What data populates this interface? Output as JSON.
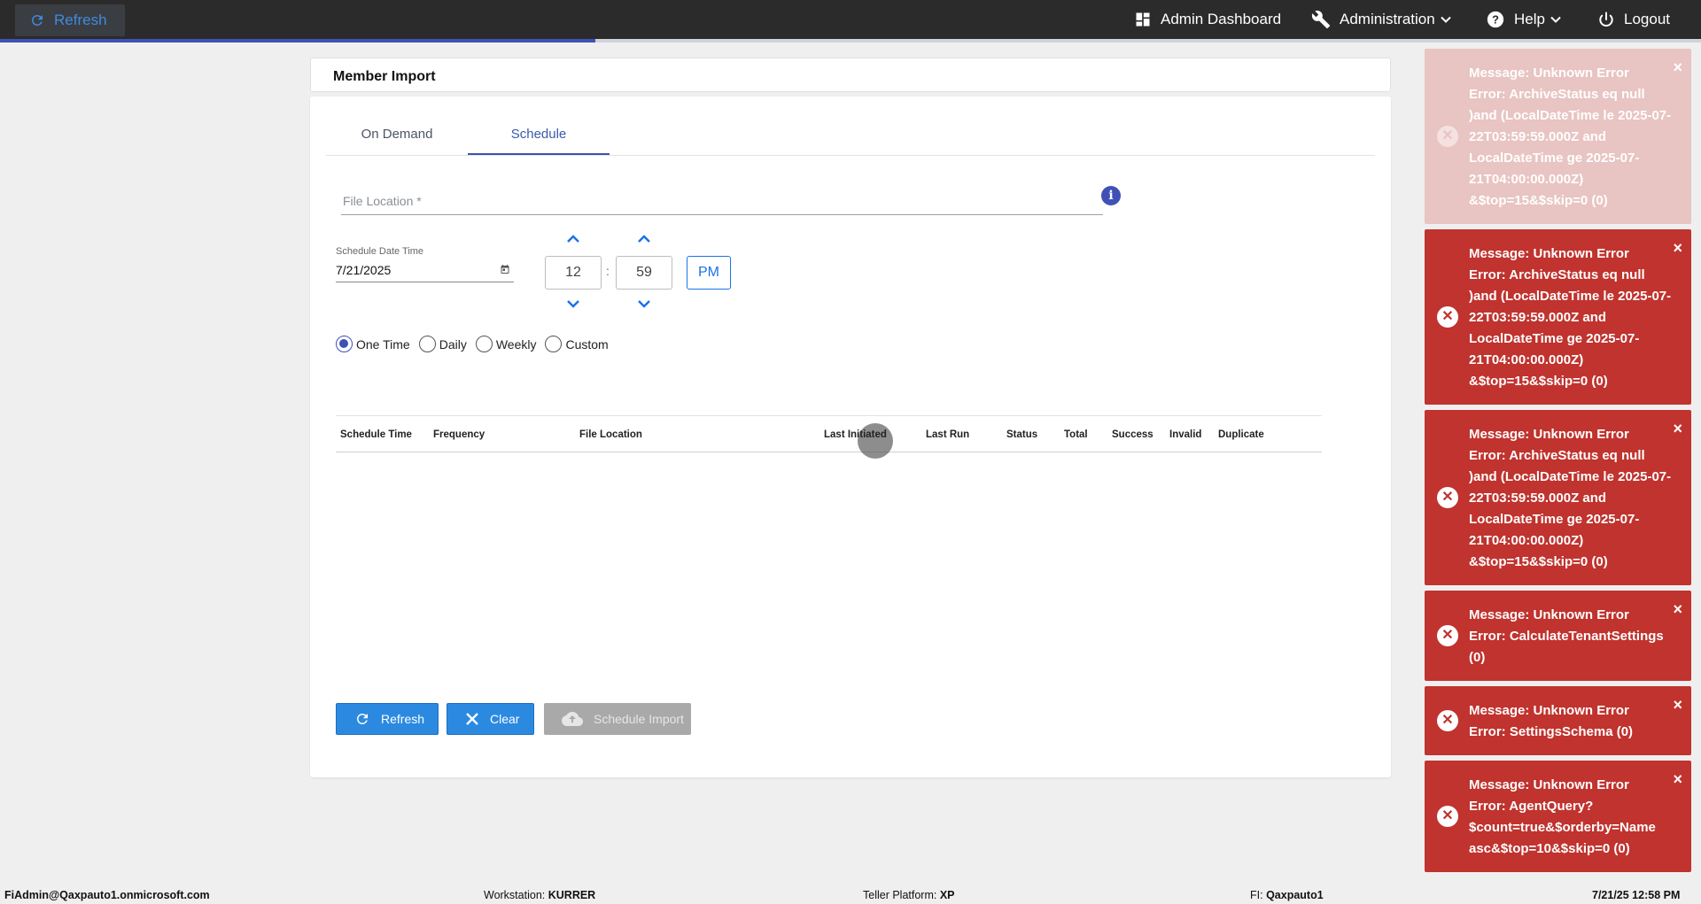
{
  "topbar": {
    "refresh_label": "Refresh",
    "admin_dashboard": "Admin Dashboard",
    "administration": "Administration",
    "help": "Help",
    "logout": "Logout",
    "progress_percent": 35
  },
  "page": {
    "title": "Member Import",
    "tabs": [
      "On Demand",
      "Schedule"
    ],
    "active_tab": "Schedule",
    "file_location_placeholder": "File Location *",
    "info_icon_label": "i",
    "schedule_date_label": "Schedule Date Time",
    "schedule_date_value": "7/21/2025",
    "hour": "12",
    "minute": "59",
    "colon": ":",
    "meridiem": "PM",
    "frequency_options": [
      "One Time",
      "Daily",
      "Weekly",
      "Custom"
    ],
    "selected_frequency": "One Time",
    "table_columns": [
      "Schedule Time",
      "Frequency",
      "File Location",
      "Last Initiated",
      "Last Run",
      "Status",
      "Total",
      "Success",
      "Invalid",
      "Duplicate"
    ],
    "buttons": {
      "refresh": "Refresh",
      "clear": "Clear",
      "schedule_import": "Schedule Import"
    }
  },
  "toasts": [
    {
      "lines": [
        "Message: Unknown Error",
        "Error: ArchiveStatus eq null",
        ")and (LocalDateTime le 2025-07-",
        "22T03:59:59.000Z and",
        "LocalDateTime ge 2025-07-",
        "21T04:00:00.000Z)",
        "&$top=15&$skip=0 (0)"
      ],
      "faded": true
    },
    {
      "lines": [
        "Message: Unknown Error",
        "Error: ArchiveStatus eq null",
        ")and (LocalDateTime le 2025-07-",
        "22T03:59:59.000Z and",
        "LocalDateTime ge 2025-07-",
        "21T04:00:00.000Z)",
        "&$top=15&$skip=0 (0)"
      ],
      "faded": false
    },
    {
      "lines": [
        "Message: Unknown Error",
        "Error: ArchiveStatus eq null",
        ")and (LocalDateTime le 2025-07-",
        "22T03:59:59.000Z and",
        "LocalDateTime ge 2025-07-",
        "21T04:00:00.000Z)",
        "&$top=15&$skip=0 (0)"
      ],
      "faded": false
    },
    {
      "lines": [
        "Message: Unknown Error",
        "Error: CalculateTenantSettings",
        "(0)"
      ],
      "faded": false
    },
    {
      "lines": [
        "Message: Unknown Error",
        "Error: SettingsSchema (0)"
      ],
      "faded": false
    },
    {
      "lines": [
        "Message: Unknown Error",
        "Error: AgentQuery?",
        "$count=true&$orderby=Name",
        "asc&$top=10&$skip=0 (0)"
      ],
      "faded": false
    }
  ],
  "toast_close_symbol": "×",
  "toast_icon_symbol": "✕",
  "footer": {
    "user": "FiAdmin@Qaxpauto1.onmicrosoft.com",
    "workstation_label": "Workstation:",
    "workstation": "KURRER",
    "platform_label": "Teller Platform:",
    "platform": "XP",
    "fi_label": "FI:",
    "fi": "Qaxpauto1",
    "datetime": "7/21/25 12:58 PM"
  },
  "colors": {
    "accent": "#3f51b5",
    "button_blue": "#2b8ae0",
    "toast_red": "#c0332e",
    "topbar": "#2b2b2b"
  }
}
